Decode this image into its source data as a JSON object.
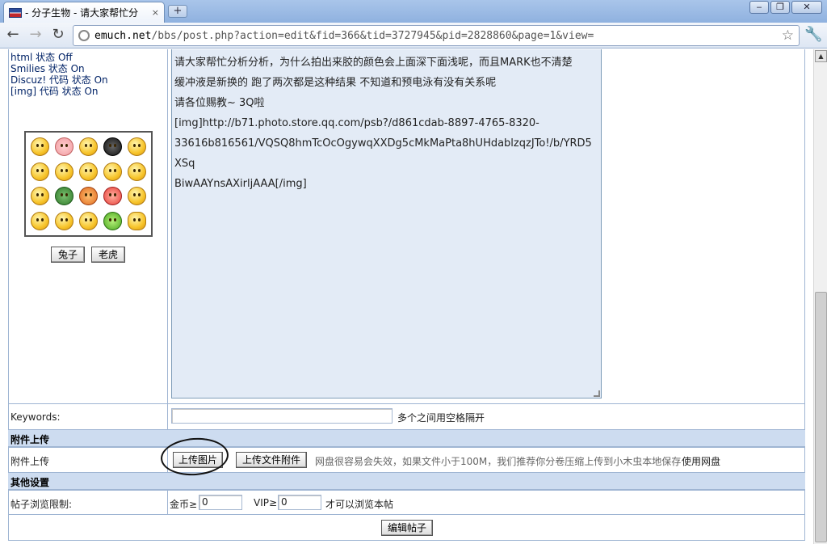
{
  "browser": {
    "tab_title": "- 分子生物 - 请大家帮忙分",
    "tab_close": "×",
    "new_tab": "+",
    "url_host": "emuch.net",
    "url_path": "/bbs/post.php?action=edit&fid=366&tid=3727945&pid=2828860&page=1&view=",
    "back": "←",
    "forward": "→",
    "reload": "↻",
    "star": "☆",
    "wrench": "🔧",
    "min": "‒",
    "max": "❐",
    "close": "✕"
  },
  "status_list": [
    "html 状态 Off",
    "Smilies 状态 On",
    "Discuz! 代码 状态 On",
    "[img] 代码 状态 On"
  ],
  "smilies_buttons": {
    "rabbit": "兔子",
    "tiger": "老虎"
  },
  "editor_lines": [
    "请大家帮忙分析分析，为什么拍出来胶的颜色会上面深下面浅呢，而且MARK也不清楚",
    "缓冲液是新换的 跑了两次都是这种结果 不知道和预电泳有没有关系呢",
    "请各位赐教~    3Q啦",
    "[img]http://b71.photo.store.qq.com/psb?/d861cdab-8897-4765-8320-",
    "33616b816561/VQSQ8hmTcOcOgywqXXDg5cMkMaPta8hUHdablzqzJTo!/b/YRD5XSq",
    "BiwAAYnsAXirljAAA[/img]"
  ],
  "keywords": {
    "label": "Keywords:",
    "value": "",
    "hint": "多个之间用空格隔开"
  },
  "attach": {
    "section": "附件上传",
    "label": "附件上传",
    "upload_image": "上传图片",
    "upload_file": "上传文件附件",
    "notice": "网盘很容易会失效，如果文件小于100M，我们推荐你分卷压缩上传到小木虫本地保存",
    "netdisk": "使用网盘"
  },
  "other": {
    "section": "其他设置",
    "label": "帖子浏览限制:",
    "gold_label": "金币≥",
    "gold_value": "0",
    "vip_label": "VIP≥",
    "vip_value": "0",
    "suffix": "才可以浏览本帖"
  },
  "submit": "编辑帖子"
}
